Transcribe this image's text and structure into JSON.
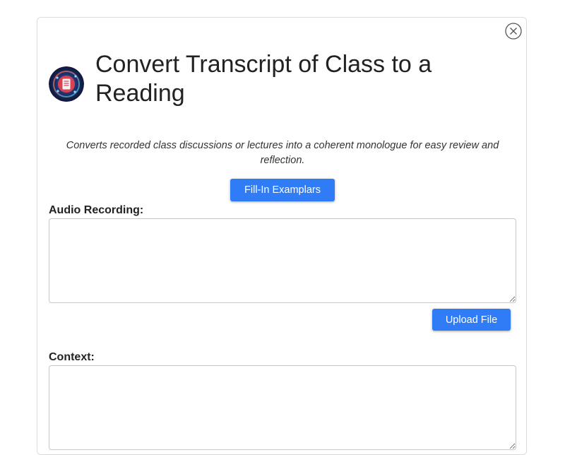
{
  "page": {
    "title": "Convert Transcript of Class to a Reading",
    "description": "Converts recorded class discussions or lectures into a coherent monologue for easy review and reflection."
  },
  "buttons": {
    "fill_in_label": "Fill-In Examplars",
    "upload_label": "Upload File"
  },
  "fields": {
    "audio_label": "Audio Recording:",
    "audio_value": "",
    "context_label": "Context:",
    "context_value": ""
  },
  "icons": {
    "close": "close-icon",
    "logo": "app-logo-icon"
  },
  "colors": {
    "accent": "#2f7cf6"
  }
}
